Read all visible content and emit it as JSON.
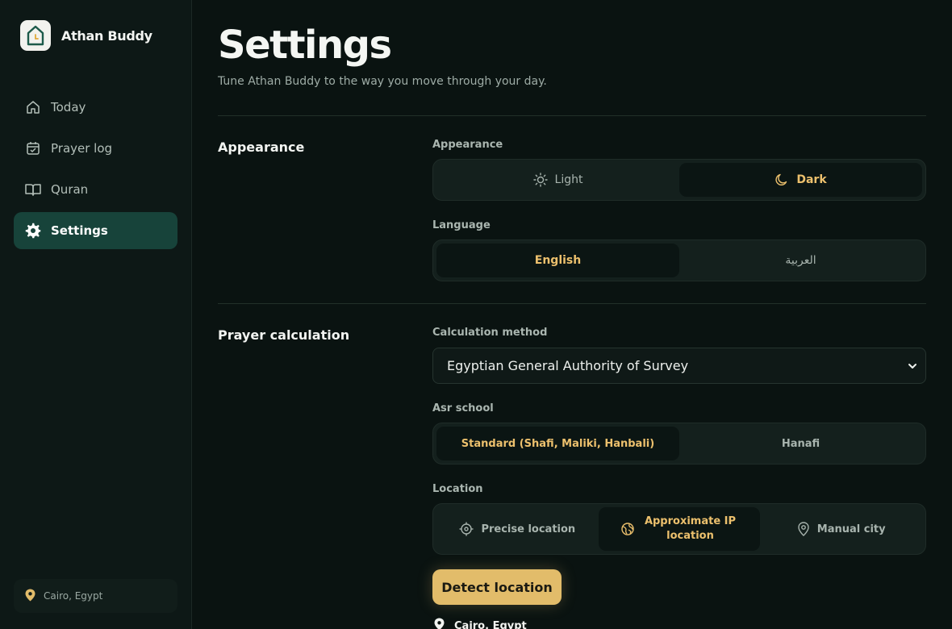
{
  "app": {
    "name": "Athan Buddy"
  },
  "sidebar": {
    "items": [
      {
        "label": "Today",
        "icon": "home-icon",
        "active": false
      },
      {
        "label": "Prayer log",
        "icon": "calendar-check-icon",
        "active": false
      },
      {
        "label": "Quran",
        "icon": "book-open-icon",
        "active": false
      },
      {
        "label": "Settings",
        "icon": "gear-icon",
        "active": true
      }
    ],
    "location": "Cairo, Egypt"
  },
  "page": {
    "title": "Settings",
    "subtitle": "Tune Athan Buddy to the way you move through your day."
  },
  "appearance_section": {
    "title": "Appearance",
    "appearance": {
      "label": "Appearance",
      "options": [
        "Light",
        "Dark"
      ],
      "selected": "Dark"
    },
    "language": {
      "label": "Language",
      "options": [
        "English",
        "العربية"
      ],
      "selected": "English"
    }
  },
  "prayer_section": {
    "title": "Prayer calculation",
    "method": {
      "label": "Calculation method",
      "value": "Egyptian General Authority of Survey"
    },
    "asr": {
      "label": "Asr school",
      "options": [
        "Standard (Shafi, Maliki, Hanbali)",
        "Hanafi"
      ],
      "selected": "Standard (Shafi, Maliki, Hanbali)"
    },
    "location": {
      "label": "Location",
      "options": [
        "Precise location",
        "Approximate IP location",
        "Manual city"
      ],
      "selected": "Approximate IP location",
      "detect_label": "Detect location",
      "current": "Cairo, Egypt"
    }
  },
  "colors": {
    "accent": "#e2bc6a",
    "active_nav": "#17433a",
    "background": "#0a1311"
  }
}
